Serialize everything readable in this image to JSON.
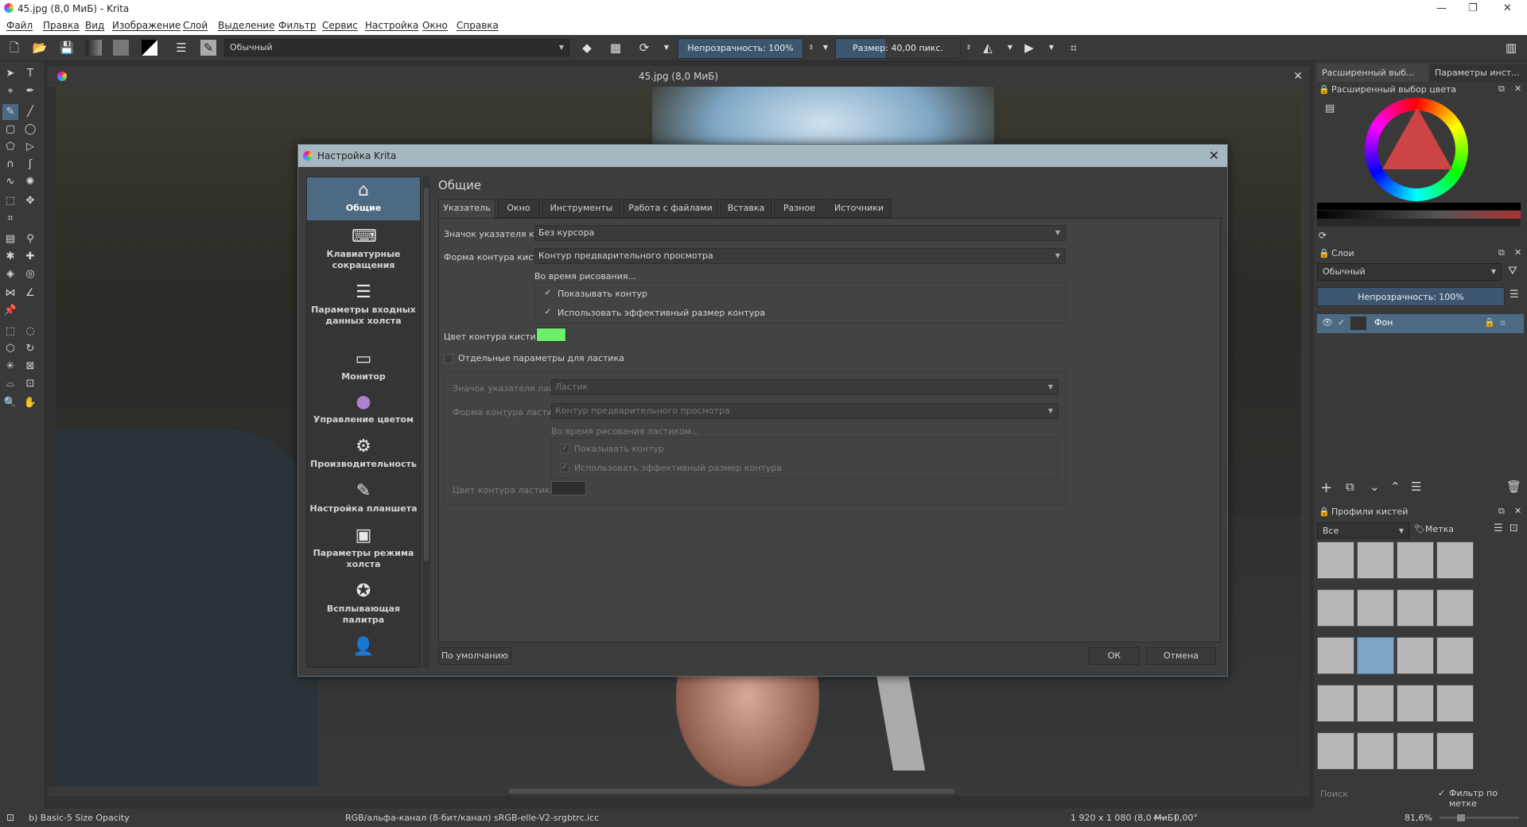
{
  "window": {
    "title": "45.jpg (8,0 МиБ)  - Krita",
    "minimize": "—",
    "maximize": "❐",
    "close": "✕"
  },
  "menu": [
    "Файл",
    "Правка",
    "Вид",
    "Изображение",
    "Слой",
    "Выделение",
    "Фильтр",
    "Сервис",
    "Настройка",
    "Окно",
    "Справка"
  ],
  "toolbar": {
    "blend_mode": "Обычный",
    "opacity": "Непрозрачность: 100%",
    "size": "Размер: 40,00 пикс."
  },
  "document": {
    "tab_title": "45.jpg (8,0 МиБ)"
  },
  "dialog": {
    "title": "Настройка Krita",
    "page_title": "Общие",
    "nav": [
      {
        "label": "Общие",
        "icon": "home-icon",
        "glyph": "⌂"
      },
      {
        "label": "Клавиатурные сокращения",
        "icon": "keyboard-icon",
        "glyph": "⌨"
      },
      {
        "label": "Параметры входных данных холста",
        "icon": "input-settings-icon",
        "glyph": "☰"
      },
      {
        "label": "Монитор",
        "icon": "monitor-icon",
        "glyph": "▭"
      },
      {
        "label": "Управление цветом",
        "icon": "color-management-icon",
        "glyph": "●"
      },
      {
        "label": "Производительность",
        "icon": "performance-icon",
        "glyph": "⚙"
      },
      {
        "label": "Настройка планшета",
        "icon": "tablet-icon",
        "glyph": "✎"
      },
      {
        "label": "Параметры режима холста",
        "icon": "canvas-mode-icon",
        "glyph": "▣"
      },
      {
        "label": "Всплывающая палитра",
        "icon": "popup-palette-icon",
        "glyph": "✪"
      }
    ],
    "tabs": [
      "Указатель",
      "Окно",
      "Инструменты",
      "Работа с файлами",
      "Вставка",
      "Разное",
      "Источники"
    ],
    "cursor": {
      "brush_icon_label": "Значок указателя кисти:",
      "brush_icon_value": "Без курсора",
      "brush_outline_label": "Форма контура кисти:",
      "brush_outline_value": "Контур предварительного просмотра",
      "while_painting": "Во время рисования...",
      "show_outline": "Показывать контур",
      "effective_size": "Использовать эффективный размер контура",
      "outline_color_label": "Цвет контура кисти:",
      "outline_color": "#6cf06c",
      "separate_eraser": "Отдельные параметры для ластика",
      "eraser_icon_label": "Значок указателя ластика:",
      "eraser_icon_value": "Ластик",
      "eraser_outline_label": "Форма контура ластика:",
      "eraser_outline_value": "Контур предварительного просмотра",
      "while_erasing": "Во время рисования ластиком...",
      "eraser_show_outline": "Показывать контур",
      "eraser_effective_size": "Использовать эффективный размер контура",
      "eraser_color_label": "Цвет контура ластика:",
      "eraser_color": "#2e2e2e"
    },
    "defaults_button": "По умолчанию",
    "ok_button": "ОК",
    "cancel_button": "Отмена"
  },
  "right_panel": {
    "tab_color": "Расширенный выб...",
    "tab_tool": "Параметры инст...",
    "color_selector_title": "Расширенный выбор цвета",
    "layers_title": "Слои",
    "layers_blend": "Обычный",
    "layers_opacity": "Непрозрачность:  100%",
    "layer_name": "Фон",
    "brushes_title": "Профили кистей",
    "brushes_filter": "Все",
    "brushes_tag": "Метка",
    "search_placeholder": "Поиск",
    "filter_by_tag": "Фильтр по метке"
  },
  "status": {
    "brush": "b) Basic-5 Size Opacity",
    "color_space": "RGB/альфа-канал (8-бит/канал)  sRGB-elle-V2-srgbtrc.icc",
    "dimensions": "1 920 x 1 080 (8,0 МиБ)",
    "rotation": "0,00°",
    "zoom": "81,6%"
  }
}
